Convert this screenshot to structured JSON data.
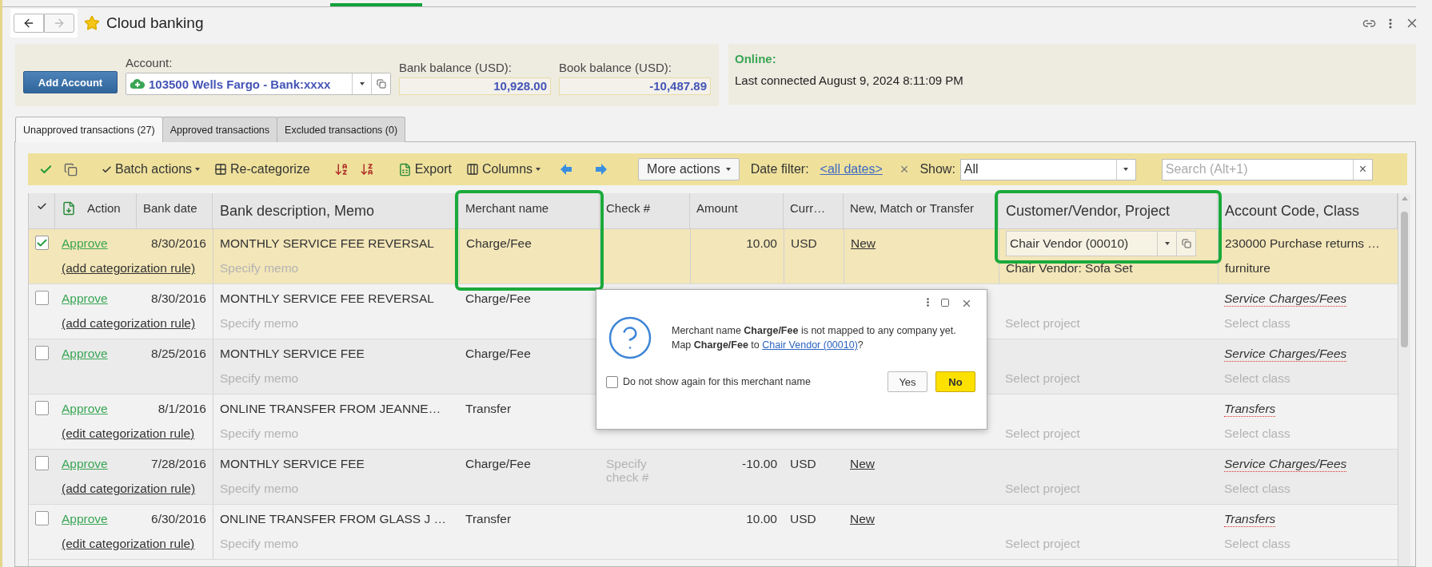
{
  "header": {
    "title": "Cloud banking",
    "starred": true
  },
  "account_panel": {
    "add_button": "Add Account",
    "account_label": "Account:",
    "account_value": "103500 Wells Fargo - Bank:xxxx",
    "bank_balance_label": "Bank balance (USD):",
    "bank_balance": "10,928.00",
    "book_balance_label": "Book balance (USD):",
    "book_balance": "-10,487.89"
  },
  "connection": {
    "status": "Online:",
    "detail": "Last connected August 9, 2024 8:11:09 PM"
  },
  "tabs": [
    {
      "label": "Unapproved transactions (27)",
      "selected": true
    },
    {
      "label": "Approved transactions",
      "selected": false
    },
    {
      "label": "Excluded transactions (0)",
      "selected": false
    }
  ],
  "toolbar": {
    "batch_actions": "Batch actions",
    "recategorize": "Re-categorize",
    "export": "Export",
    "columns": "Columns",
    "more_actions": "More actions",
    "date_filter_label": "Date filter:",
    "date_filter_value": "<all dates>",
    "date_clear": "×",
    "show_label": "Show:",
    "show_value": "All",
    "search_placeholder": "Search (Alt+1)",
    "search_clear": "×"
  },
  "table": {
    "columns": [
      {
        "label": "Action",
        "large": false
      },
      {
        "label": "Bank date",
        "large": false
      },
      {
        "label": "Bank description, Memo",
        "large": true
      },
      {
        "label": "Merchant name",
        "large": false
      },
      {
        "label": "Check #",
        "large": false
      },
      {
        "label": "Amount",
        "large": false
      },
      {
        "label": "Curr…",
        "large": false
      },
      {
        "label": "New, Match or Transfer",
        "large": false
      },
      {
        "label": "Customer/Vendor, Project",
        "large": true
      },
      {
        "label": "Account Code, Class",
        "large": true
      }
    ],
    "rows": [
      {
        "selected": true,
        "checked": true,
        "action": "Approve",
        "rule": "(add categorization rule)",
        "date": "8/30/2016",
        "description": "MONTHLY SERVICE FEE REVERSAL",
        "memo_placeholder": "Specify memo",
        "merchant": "Charge/Fee",
        "amount": "10.00",
        "currency": "USD",
        "match": "New",
        "customer": "Chair Vendor (00010)",
        "project": "Chair Vendor: Sofa Set",
        "account": "230000 Purchase returns …",
        "account_suggested": false,
        "class": "furniture"
      },
      {
        "selected": false,
        "checked": false,
        "action": "Approve",
        "rule": "(add categorization rule)",
        "date": "8/30/2016",
        "description": "MONTHLY SERVICE FEE REVERSAL",
        "memo_placeholder": "Specify memo",
        "merchant": "Charge/Fee",
        "project_placeholder": "Select project",
        "account": "Service Charges/Fees",
        "account_suggested": true,
        "class_placeholder": "Select class"
      },
      {
        "selected": false,
        "checked": false,
        "action": "Approve",
        "rule": "",
        "date": "8/25/2016",
        "description": "MONTHLY SERVICE FEE",
        "memo_placeholder": "Specify memo",
        "merchant": "Charge/Fee",
        "project_placeholder": "Select project",
        "account": "Service Charges/Fees",
        "account_suggested": true,
        "class_placeholder": "Select class"
      },
      {
        "selected": false,
        "checked": false,
        "action": "Approve",
        "rule": "(edit categorization rule)",
        "date": "8/1/2016",
        "description": "ONLINE TRANSFER FROM JEANNE…",
        "memo_placeholder": "Specify memo",
        "merchant": "Transfer",
        "project_placeholder": "Select project",
        "account": "Transfers",
        "account_suggested": true,
        "class_placeholder": "Select class"
      },
      {
        "selected": false,
        "checked": false,
        "action": "Approve",
        "rule": "(add categorization rule)",
        "date": "7/28/2016",
        "description": "MONTHLY SERVICE FEE",
        "memo_placeholder": "Specify memo",
        "merchant": "Charge/Fee",
        "check_placeholder": "Specify check #",
        "amount": "-10.00",
        "currency": "USD",
        "match": "New",
        "project_placeholder": "Select project",
        "account": "Service Charges/Fees",
        "account_suggested": true,
        "class_placeholder": "Select class"
      },
      {
        "selected": false,
        "checked": false,
        "action": "Approve",
        "rule": "(edit categorization rule)",
        "date": "6/30/2016",
        "description": "ONLINE TRANSFER FROM GLASS J …",
        "memo_placeholder": "Specify memo",
        "merchant": "Transfer",
        "amount": "10.00",
        "currency": "USD",
        "match": "New",
        "project_placeholder": "Select project",
        "account": "Transfers",
        "account_suggested": true,
        "class_placeholder": "Select class"
      }
    ]
  },
  "dialog": {
    "message_line1": "Merchant name **Charge/Fee** is not mapped to any company yet.",
    "message_line2": "Map **Charge/Fee** to",
    "link": "Chair Vendor (00010)",
    "message_end": "?",
    "checkbox_label": "Do not show again for this merchant name",
    "checkbox_checked": false,
    "buttons": [
      {
        "label": "Yes",
        "default": false
      },
      {
        "label": "No",
        "default": true
      }
    ]
  }
}
